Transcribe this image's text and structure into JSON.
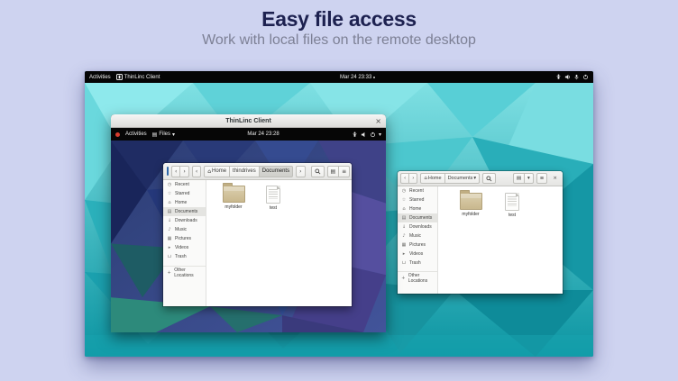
{
  "page": {
    "title": "Easy file access",
    "subtitle": "Work with local files on the remote desktop"
  },
  "host_desktop": {
    "topbar": {
      "activities_label": "Activities",
      "focused_app": "ThinLinc Client",
      "clock": "Mar 24 23:33"
    }
  },
  "thinlinc_window": {
    "title": "ThinLinc Client",
    "topbar": {
      "activities_label": "Activities",
      "app_menu_label": "Files",
      "clock": "Mar 24 23:28"
    }
  },
  "remote_files_window": {
    "path_segments": [
      "Home",
      "thindrives",
      "Documents"
    ],
    "active_segment": "Documents",
    "files": [
      {
        "label": "myfolder",
        "type": "folder"
      },
      {
        "label": "test",
        "type": "document"
      }
    ]
  },
  "local_files_window": {
    "path_segments": [
      "Home",
      "Documents"
    ],
    "active_segment": "Documents",
    "files": [
      {
        "label": "myfolder",
        "type": "folder"
      },
      {
        "label": "test",
        "type": "document"
      }
    ]
  },
  "files_sidebar": {
    "active_item": "Documents",
    "items": [
      "Recent",
      "Starred",
      "Home",
      "Documents",
      "Downloads",
      "Music",
      "Pictures",
      "Videos",
      "Trash",
      "Other Locations"
    ]
  },
  "icons": {
    "recent": "◷",
    "starred": "☆",
    "home": "⌂",
    "documents": "▤",
    "downloads": "↓",
    "music": "♪",
    "pictures": "▦",
    "videos": "▸",
    "trash": "⊔",
    "other_locations": "+",
    "back": "‹",
    "forward": "›",
    "overflow": "‹",
    "nav_more": "›",
    "chevron_down": "▾",
    "menu": "≡",
    "view_grid": "▤",
    "files_app": "▤",
    "close": "×"
  },
  "colors": {
    "page_background": "#ced3f0",
    "title_text": "#1d2150",
    "subtitle_text": "#7d8095",
    "host_desktop_teal": "#149fae",
    "remote_desktop_blue": "#31508f",
    "accent_blue": "#3c7bc4",
    "folder_tan": "#cdbc95"
  }
}
